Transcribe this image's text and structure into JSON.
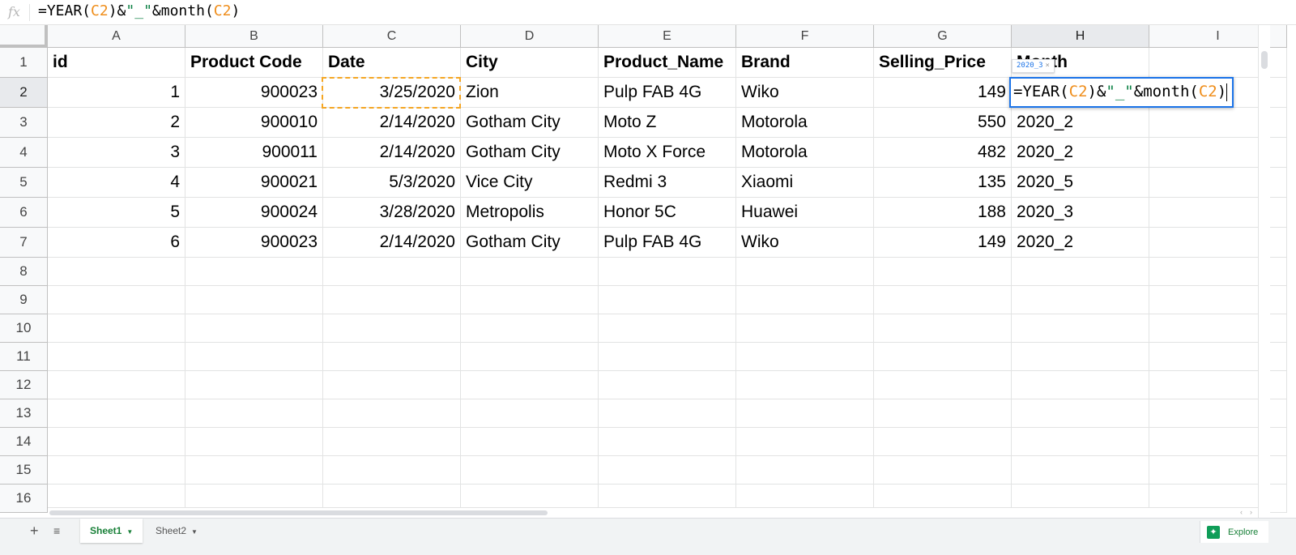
{
  "formula_bar": {
    "icon": "fx",
    "tokens": [
      {
        "t": "=YEAR(",
        "k": "plain"
      },
      {
        "t": "C2",
        "k": "ref"
      },
      {
        "t": ")&",
        "k": "plain"
      },
      {
        "t": "\"_\"",
        "k": "str"
      },
      {
        "t": "&month(",
        "k": "plain"
      },
      {
        "t": "C2",
        "k": "ref"
      },
      {
        "t": ")",
        "k": "plain"
      }
    ]
  },
  "columns": [
    "A",
    "B",
    "C",
    "D",
    "E",
    "F",
    "G",
    "H",
    "I"
  ],
  "selected_column": "H",
  "rows": [
    "1",
    "2",
    "3",
    "4",
    "5",
    "6",
    "7",
    "8",
    "9",
    "10",
    "11",
    "12",
    "13",
    "14",
    "15",
    "16"
  ],
  "selected_row": "2",
  "header_row": [
    "id",
    "Product Code",
    "Date",
    "City",
    "Product_Name",
    "Brand",
    "Selling_Price",
    "Month"
  ],
  "data_rows": [
    [
      "1",
      "900023",
      "3/25/2020",
      "Zion",
      "Pulp FAB 4G",
      "Wiko",
      "149",
      ""
    ],
    [
      "2",
      "900010",
      "2/14/2020",
      "Gotham City",
      "Moto Z",
      "Motorola",
      "550",
      "2020_2"
    ],
    [
      "3",
      "900011",
      "2/14/2020",
      "Gotham City",
      "Moto X Force",
      "Motorola",
      "482",
      "2020_2"
    ],
    [
      "4",
      "900021",
      "5/3/2020",
      "Vice City",
      "Redmi 3",
      "Xiaomi",
      "135",
      "2020_5"
    ],
    [
      "5",
      "900024",
      "3/28/2020",
      "Metropolis",
      "Honor 5C",
      "Huawei",
      "188",
      "2020_3"
    ],
    [
      "6",
      "900023",
      "2/14/2020",
      "Gotham City",
      "Pulp FAB 4G",
      "Wiko",
      "149",
      "2020_2"
    ]
  ],
  "numeric_columns": [
    0,
    1,
    2,
    6
  ],
  "editing_cell": "H2",
  "preview_tooltip": {
    "value": "2020_3",
    "close": "×"
  },
  "sheets": [
    {
      "label": "Sheet1",
      "active": true
    },
    {
      "label": "Sheet2",
      "active": false
    }
  ],
  "add_sheet_icon": "+",
  "sheet_list_icon": "≡",
  "explore": {
    "label": "Explore",
    "icon": "explore-icon"
  },
  "colors": {
    "ref": "#ef8e1c",
    "string": "#0b8043",
    "selection": "#1a73e8",
    "copy_border": "#f5a623",
    "active_tab": "#188038"
  }
}
